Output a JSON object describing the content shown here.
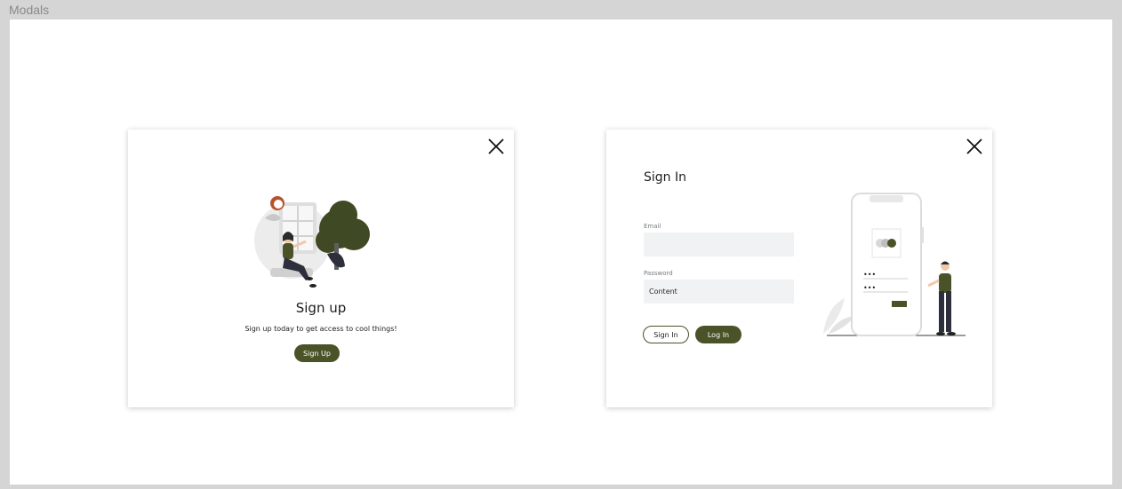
{
  "frame": {
    "label": "Modals"
  },
  "signup_modal": {
    "title": "Sign up",
    "subtitle": "Sign up today to get access to cool things!",
    "button_label": "Sign Up"
  },
  "signin_modal": {
    "title": "Sign In",
    "email_label": "Email",
    "email_value": "",
    "password_label": "Password",
    "password_value": "Content",
    "signin_button_label": "Sign In",
    "login_button_label": "Log In"
  },
  "colors": {
    "accent": "#4a5228",
    "canvas_bg": "#d5d5d5",
    "field_bg": "#f1f2f3"
  }
}
